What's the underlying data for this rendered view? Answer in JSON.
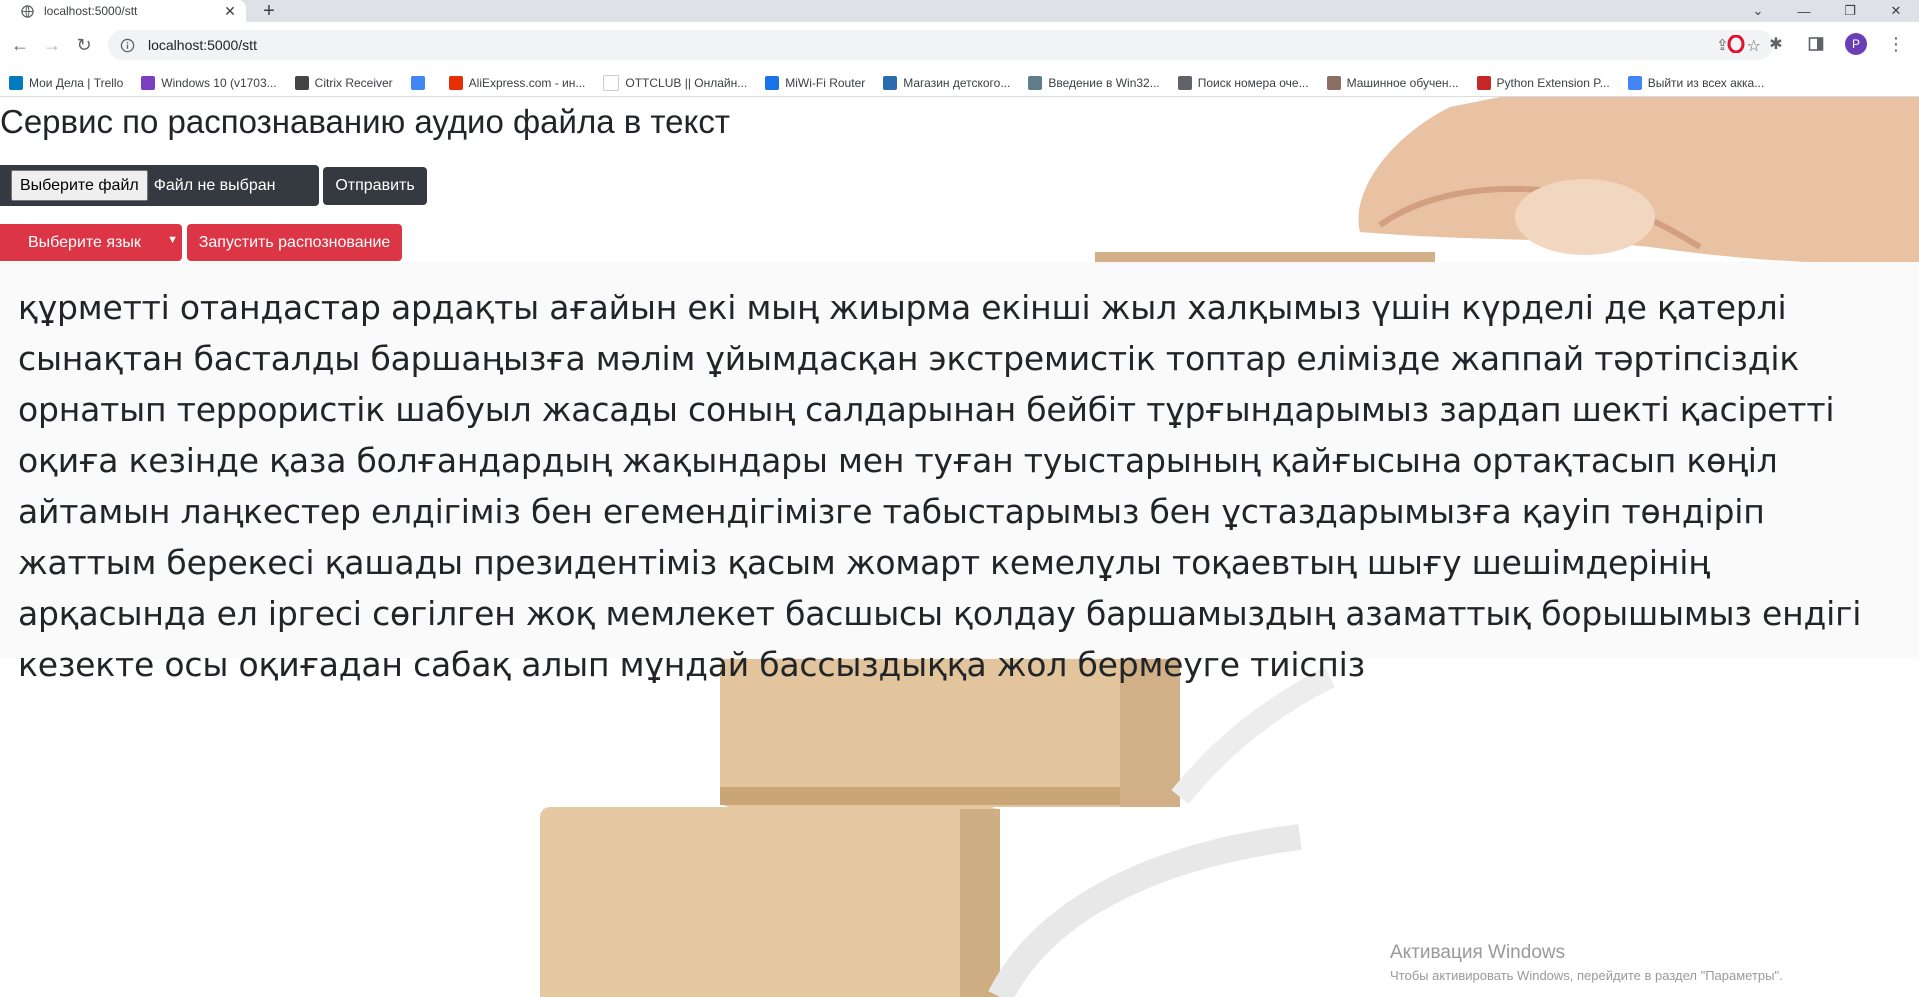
{
  "browser": {
    "tab_title": "localhost:5000/stt",
    "url": "localhost:5000/stt",
    "profile_initial": "P",
    "bookmarks": [
      {
        "label": "Мои Дела | Trello",
        "icon_color": "#0079bf"
      },
      {
        "label": "Windows 10 (v1703...",
        "icon_color": "#7b3fbf"
      },
      {
        "label": "Citrix Receiver",
        "icon_color": "#444444"
      },
      {
        "label": "",
        "icon_color": "#4285f4"
      },
      {
        "label": "AliExpress.com - ин...",
        "icon_color": "#e62e04"
      },
      {
        "label": "OTTCLUB || Онлайн...",
        "icon_color": "#ffffff"
      },
      {
        "label": "MiWi-Fi Router",
        "icon_color": "#1a73e8"
      },
      {
        "label": "Магазин детского...",
        "icon_color": "#2b6cb0"
      },
      {
        "label": "Введение в Win32...",
        "icon_color": "#607d8b"
      },
      {
        "label": "Поиск номера оче...",
        "icon_color": "#5f6368"
      },
      {
        "label": "Машинное обучен...",
        "icon_color": "#8d6e63"
      },
      {
        "label": "Python Extension P...",
        "icon_color": "#c62828"
      },
      {
        "label": "Выйти из всех акка...",
        "icon_color": "#4285f4"
      }
    ]
  },
  "page": {
    "title": "Сервис по распознаванию аудио файла в текст",
    "file_button": "Выберите файл",
    "file_status": "Файл не выбран",
    "send_button": "Отправить",
    "language_select": "Выберите язык",
    "run_button": "Запустить распознование",
    "result_text": "құрметті отандастар ардақты ағайын екі мың жиырма екінші жыл халқымыз үшін күрделі де қатерлі сынақтан басталды баршаңызға мәлім ұйымдасқан экстремистік топтар елімізде жаппай тәртіпсіздік орнатып террористік шабуыл жасады соның салдарынан бейбіт тұрғындарымыз зардап шекті қасіретті оқиға кезінде қаза болғандардың жақындары мен туған туыстарының қайғысына ортақтасып көңіл айтамын лаңкестер елдігіміз бен егемендігімізге табыстарымыз бен ұстаздарымызға қауіп төндіріп жаттым берекесі қашады президентіміз қасым жомарт кемелұлы тоқаевтың шығу шешімдерінің арқасында ел іргесі сөгілген жоқ мемлекет басшысы қолдау баршамыздың азаматтық борышымыз ендігі кезекте осы оқиғадан сабақ алып мұндай бассыздыққа жол бермеуге тиіспіз"
  },
  "watermark": {
    "title": "Активация Windows",
    "subtitle": "Чтобы активировать Windows, перейдите в раздел \"Параметры\"."
  },
  "colors": {
    "dark_button": "#343a40",
    "danger_button": "#dc3545"
  }
}
